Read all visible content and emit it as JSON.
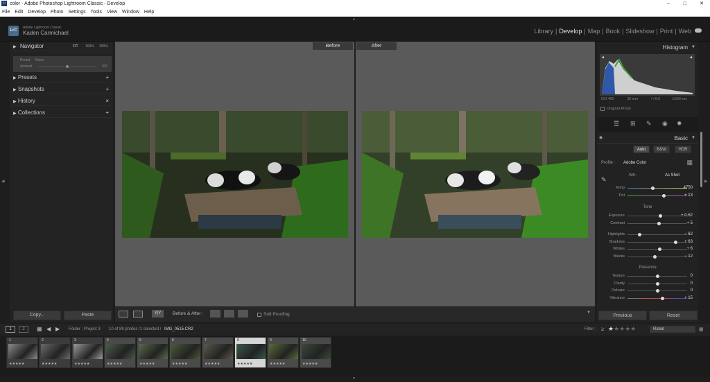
{
  "window": {
    "title": "color - Adobe Photoshop Lightroom Classic - Develop"
  },
  "menu": [
    "File",
    "Edit",
    "Develop",
    "Photo",
    "Settings",
    "Tools",
    "View",
    "Window",
    "Help"
  ],
  "identity": {
    "app_name": "Adobe Lightroom Classic",
    "user": "Kaden Carmichael",
    "logo": "LrC"
  },
  "modules": [
    "Library",
    "Develop",
    "Map",
    "Book",
    "Slideshow",
    "Print",
    "Web"
  ],
  "active_module": "Develop",
  "left_panel": {
    "navigator": {
      "label": "Navigator",
      "zooms": [
        "FIT",
        "100%",
        "200%"
      ]
    },
    "preset_row": {
      "preset_label": "Preset",
      "preset_value": "None",
      "amount_label": "Amount",
      "amount_value": "100"
    },
    "sections": [
      "Presets",
      "Snapshots",
      "History",
      "Collections"
    ],
    "copy": "Copy...",
    "paste": "Paste"
  },
  "viewer": {
    "before_label": "Before",
    "after_label": "After"
  },
  "toolbar": {
    "before_after": "Before & After :",
    "yy": "Y|Y",
    "soft_proofing": "Soft Proofing"
  },
  "right_panel": {
    "histogram_title": "Histogram",
    "histogram_info": [
      "ISO 400",
      "35 mm",
      "f / 8.0",
      "1/160 sec"
    ],
    "original_photo": "Original Photo",
    "basic_title": "Basic",
    "modes": [
      "Auto",
      "B&W",
      "HDR"
    ],
    "profile_label": "Profile :",
    "profile_value": "Adobe Color",
    "wb_label": "WB :",
    "wb_value": "As Shot",
    "sliders_wb": [
      {
        "label": "Temp",
        "value": "4750",
        "pos": 0.42
      },
      {
        "label": "Tint",
        "value": "+ 13",
        "pos": 0.6
      }
    ],
    "tone_title": "Tone",
    "sliders_tone1": [
      {
        "label": "Exposure",
        "value": "+ 0.62",
        "pos": 0.55
      },
      {
        "label": "Contrast",
        "value": "+ 5",
        "pos": 0.52
      }
    ],
    "sliders_tone2": [
      {
        "label": "Highlights",
        "value": "− 62",
        "pos": 0.2
      },
      {
        "label": "Shadows",
        "value": "+ 63",
        "pos": 0.8
      },
      {
        "label": "Whites",
        "value": "+ 6",
        "pos": 0.53
      },
      {
        "label": "Blacks",
        "value": "− 12",
        "pos": 0.45
      }
    ],
    "presence_title": "Presence",
    "sliders_presence": [
      {
        "label": "Texture",
        "value": "0",
        "pos": 0.5
      },
      {
        "label": "Clarity",
        "value": "0",
        "pos": 0.5
      },
      {
        "label": "Dehaze",
        "value": "0",
        "pos": 0.5
      },
      {
        "label": "Vibrance",
        "value": "+ 15",
        "pos": 0.58
      }
    ],
    "previous": "Previous",
    "reset": "Reset"
  },
  "filmstrip": {
    "pages": [
      "1",
      "2"
    ],
    "folder": "Folder : Project 3",
    "count": "10 of 89 photos /1 selected /",
    "filename": "IMG_0515.CR2",
    "filter_label": "Filter :",
    "filter_op": "≥",
    "filter_value": "Rated",
    "thumbs": [
      "1",
      "2",
      "3",
      "4",
      "5",
      "6",
      "7",
      "8",
      "9",
      "10"
    ],
    "selected_index": 7
  }
}
